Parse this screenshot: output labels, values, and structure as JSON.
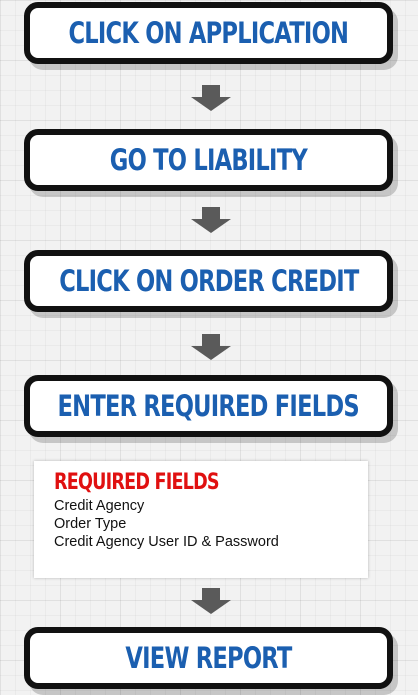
{
  "steps": [
    {
      "label": "CLICK ON APPLICATION"
    },
    {
      "label": "GO TO LIABILITY"
    },
    {
      "label": "CLICK ON ORDER CREDIT"
    },
    {
      "label": "ENTER REQUIRED FIELDS"
    },
    {
      "label": "VIEW REPORT"
    }
  ],
  "required_fields": {
    "title": "REQUIRED FIELDS",
    "items": [
      "Credit Agency",
      "Order Type",
      "Credit Agency User ID & Password"
    ]
  },
  "colors": {
    "step_text": "#1b5fb0",
    "step_border": "#111111",
    "arrow": "#5a5a5a",
    "required_title": "#e01010",
    "background": "#f2f2f2"
  }
}
